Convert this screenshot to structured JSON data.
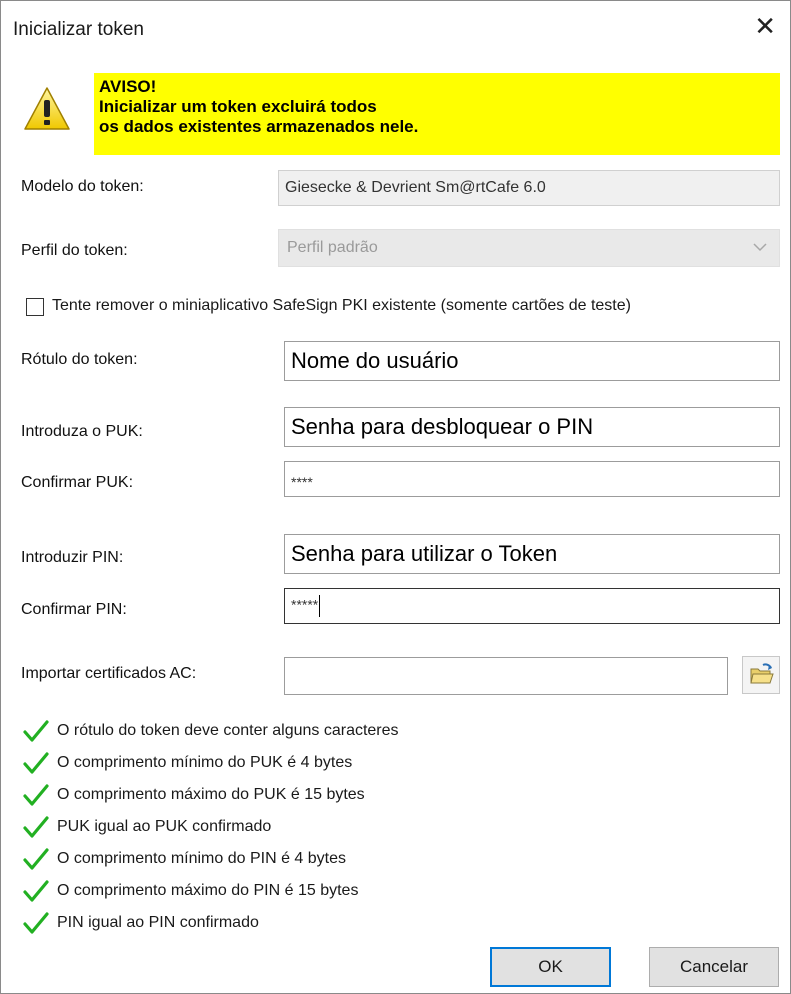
{
  "window": {
    "title": "Inicializar token",
    "close_symbol": "✕"
  },
  "warning": {
    "icon": "warning-triangle-icon",
    "heading": "AVISO!",
    "line1": "Inicializar um token excluirá todos",
    "line2": "os dados existentes armazenados nele."
  },
  "form": {
    "model_label": "Modelo do token:",
    "model_value": "Giesecke & Devrient Sm@rtCafe 6.0",
    "profile_label": "Perfil do token:",
    "profile_value": "Perfil padrão",
    "remove_applet_label": "Tente remover o miniaplicativo SafeSign PKI existente (somente cartões de teste)",
    "remove_applet_checked": false,
    "token_label_label": "Rótulo do token:",
    "token_label_value": "Nome do usuário",
    "puk_label": "Introduza o PUK:",
    "puk_value": "Senha para desbloquear o PIN",
    "confirm_puk_label": "Confirmar PUK:",
    "confirm_puk_value": "****",
    "pin_label": "Introduzir PIN:",
    "pin_value": "Senha para utilizar o Token",
    "confirm_pin_label": "Confirmar PIN:",
    "confirm_pin_value": "*****",
    "import_ca_label": "Importar certificados AC:",
    "import_ca_value": ""
  },
  "validations": [
    "O rótulo do token deve conter alguns caracteres",
    "O comprimento mínimo do PUK é 4 bytes",
    "O comprimento máximo do PUK é 15 bytes",
    "PUK igual ao PUK confirmado",
    "O comprimento mínimo do PIN é 4 bytes",
    "O comprimento máximo do PIN é 15 bytes",
    "PIN igual ao PIN confirmado"
  ],
  "buttons": {
    "ok": "OK",
    "cancel": "Cancelar"
  },
  "colors": {
    "warning_bg": "#ffff00",
    "check_green": "#22b022",
    "focus_blue": "#0078d7"
  }
}
